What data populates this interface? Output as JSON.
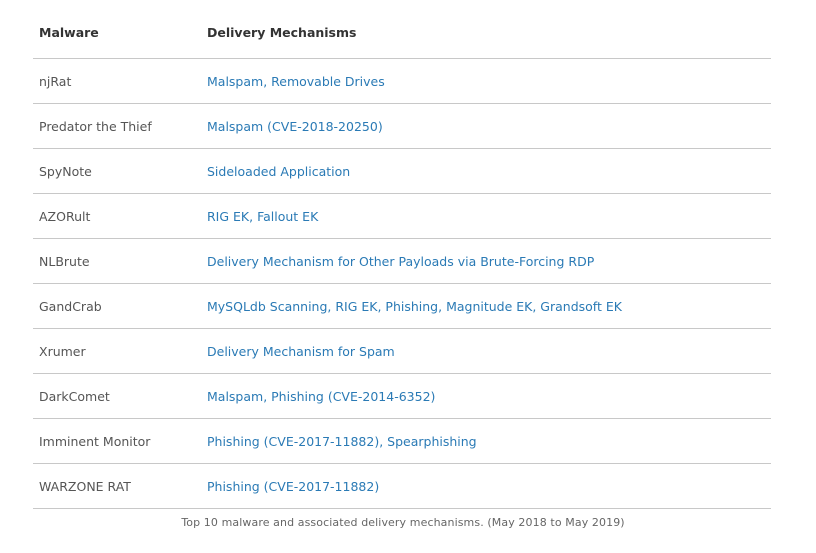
{
  "table": {
    "headers": [
      "Malware",
      "Delivery Mechanisms"
    ],
    "rows": [
      {
        "malware": "njRat",
        "delivery": "Malspam, Removable Drives"
      },
      {
        "malware": "Predator the Thief",
        "delivery": "Malspam (CVE-2018-20250)"
      },
      {
        "malware": "SpyNote",
        "delivery": "Sideloaded Application"
      },
      {
        "malware": "AZORult",
        "delivery": "RIG EK, Fallout EK"
      },
      {
        "malware": "NLBrute",
        "delivery": "Delivery Mechanism for Other Payloads via Brute-Forcing RDP"
      },
      {
        "malware": "GandCrab",
        "delivery": "MySQLdb Scanning, RIG EK, Phishing, Magnitude EK, Grandsoft EK"
      },
      {
        "malware": "Xrumer",
        "delivery": "Delivery Mechanism for Spam"
      },
      {
        "malware": "DarkComet",
        "delivery": "Malspam, Phishing (CVE-2014-6352)"
      },
      {
        "malware": "Imminent Monitor",
        "delivery": "Phishing (CVE-2017-11882), Spearphishing"
      },
      {
        "malware": "WARZONE RAT",
        "delivery": "Phishing (CVE-2017-11882)"
      }
    ]
  },
  "caption": "Top 10 malware and associated delivery mechanisms. (May 2018 to May 2019)",
  "colors": {
    "delivery_text": "#2a7ab5",
    "malware_text": "#555555",
    "header_text": "#333333",
    "divider": "#c8c8c8"
  }
}
